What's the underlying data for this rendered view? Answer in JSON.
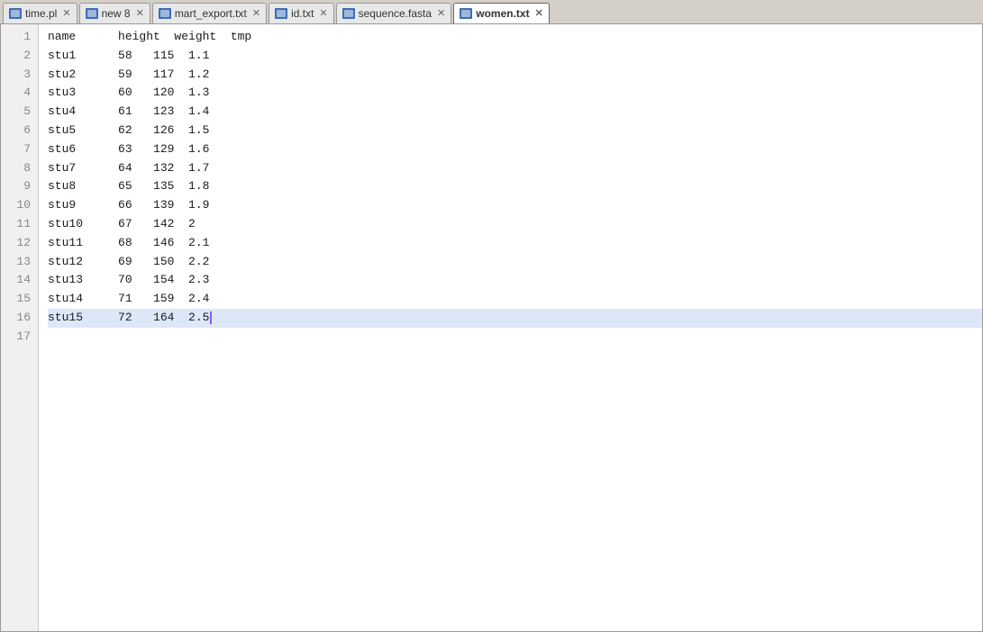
{
  "tabs": [
    {
      "id": "time",
      "label": "time.pl",
      "active": false,
      "icon": "file-icon"
    },
    {
      "id": "new8",
      "label": "new 8",
      "active": false,
      "icon": "file-icon"
    },
    {
      "id": "mart",
      "label": "mart_export.txt",
      "active": false,
      "icon": "file-icon"
    },
    {
      "id": "id",
      "label": "id.txt",
      "active": false,
      "icon": "file-icon"
    },
    {
      "id": "sequence",
      "label": "sequence.fasta",
      "active": false,
      "icon": "file-icon"
    },
    {
      "id": "women",
      "label": "women.txt",
      "active": true,
      "icon": "file-icon"
    }
  ],
  "header_row": "name      height  weight  tmp",
  "rows": [
    {
      "line": 1,
      "content": "name      height  weight  tmp",
      "highlighted": false
    },
    {
      "line": 2,
      "content": "stu1      58   115  1.1",
      "highlighted": false
    },
    {
      "line": 3,
      "content": "stu2      59   117  1.2",
      "highlighted": false
    },
    {
      "line": 4,
      "content": "stu3      60   120  1.3",
      "highlighted": false
    },
    {
      "line": 5,
      "content": "stu4      61   123  1.4",
      "highlighted": false
    },
    {
      "line": 6,
      "content": "stu5      62   126  1.5",
      "highlighted": false
    },
    {
      "line": 7,
      "content": "stu6      63   129  1.6",
      "highlighted": false
    },
    {
      "line": 8,
      "content": "stu7      64   132  1.7",
      "highlighted": false
    },
    {
      "line": 9,
      "content": "stu8      65   135  1.8",
      "highlighted": false
    },
    {
      "line": 10,
      "content": "stu9      66   139  1.9",
      "highlighted": false
    },
    {
      "line": 11,
      "content": "stu10     67   142  2",
      "highlighted": false
    },
    {
      "line": 12,
      "content": "stu11     68   146  2.1",
      "highlighted": false
    },
    {
      "line": 13,
      "content": "stu12     69   150  2.2",
      "highlighted": false
    },
    {
      "line": 14,
      "content": "stu13     70   154  2.3",
      "highlighted": false
    },
    {
      "line": 15,
      "content": "stu14     71   159  2.4",
      "highlighted": false
    },
    {
      "line": 16,
      "content": "stu15     72   164  2.5",
      "highlighted": true
    },
    {
      "line": 17,
      "content": "",
      "highlighted": false
    }
  ],
  "close_label": "✕",
  "colors": {
    "tab_bg_active": "#ffffff",
    "tab_bg_inactive": "#e8e8e8",
    "highlight": "#dce8f8",
    "cursor": "#8b5cf6"
  }
}
